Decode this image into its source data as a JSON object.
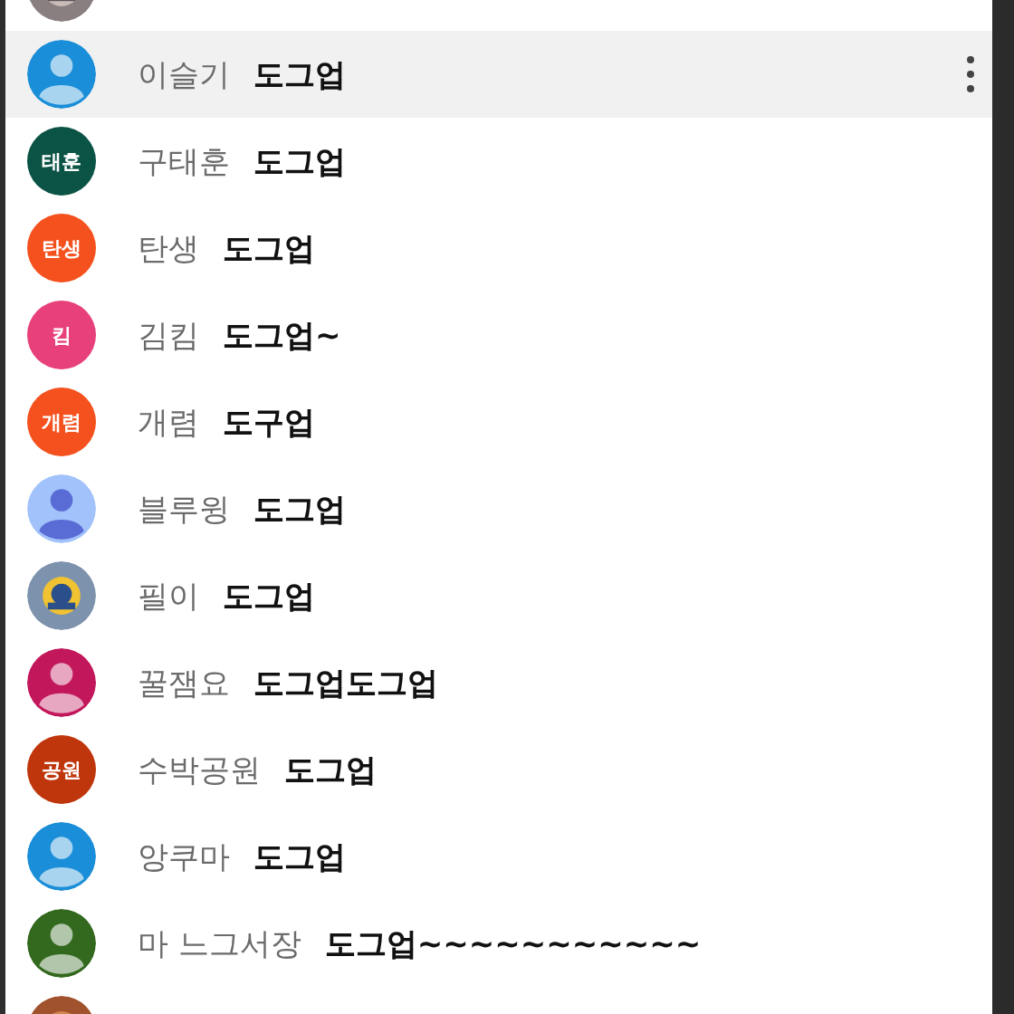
{
  "rows": [
    {
      "selected": false
    },
    {
      "avatar": {
        "kind": "person",
        "color": "#1a8ed8"
      },
      "name": "이슬기",
      "message": "도그업",
      "selected": true
    },
    {
      "avatar": {
        "kind": "initials",
        "color": "#0b5345",
        "text": "태훈"
      },
      "name": "구태훈",
      "message": "도그업",
      "selected": false
    },
    {
      "avatar": {
        "kind": "initials",
        "color": "#f4511e",
        "text": "탄생"
      },
      "name": "탄생",
      "message": "도그업",
      "selected": false
    },
    {
      "avatar": {
        "kind": "initials",
        "color": "#e8407a",
        "text": "킴"
      },
      "name": "김킴",
      "message": "도그업~",
      "selected": false
    },
    {
      "avatar": {
        "kind": "initials",
        "color": "#f4511e",
        "text": "개렴"
      },
      "name": "개렴",
      "message": "도구업",
      "selected": false
    },
    {
      "avatar": {
        "kind": "person",
        "color": "#a1c2fa"
      },
      "name": "블루윙",
      "message": "도그업",
      "selected": false
    },
    {
      "name": "필이",
      "message": "도그업",
      "selected": false
    },
    {
      "avatar": {
        "kind": "person",
        "color": "#c2185b"
      },
      "name": "꿀잼요",
      "message": "도그업도그업",
      "selected": false
    },
    {
      "avatar": {
        "kind": "initials",
        "color": "#bf360c",
        "text": "공원"
      },
      "name": "수박공원",
      "message": "도그업",
      "selected": false
    },
    {
      "avatar": {
        "kind": "person",
        "color": "#1a8ed8"
      },
      "name": "앙쿠마",
      "message": "도그업",
      "selected": false
    },
    {
      "avatar": {
        "kind": "person",
        "color": "#33691e"
      },
      "name": "마 느그서장",
      "message": "도그업~~~~~~~~~~~",
      "selected": false
    },
    {
      "selected": false
    }
  ]
}
